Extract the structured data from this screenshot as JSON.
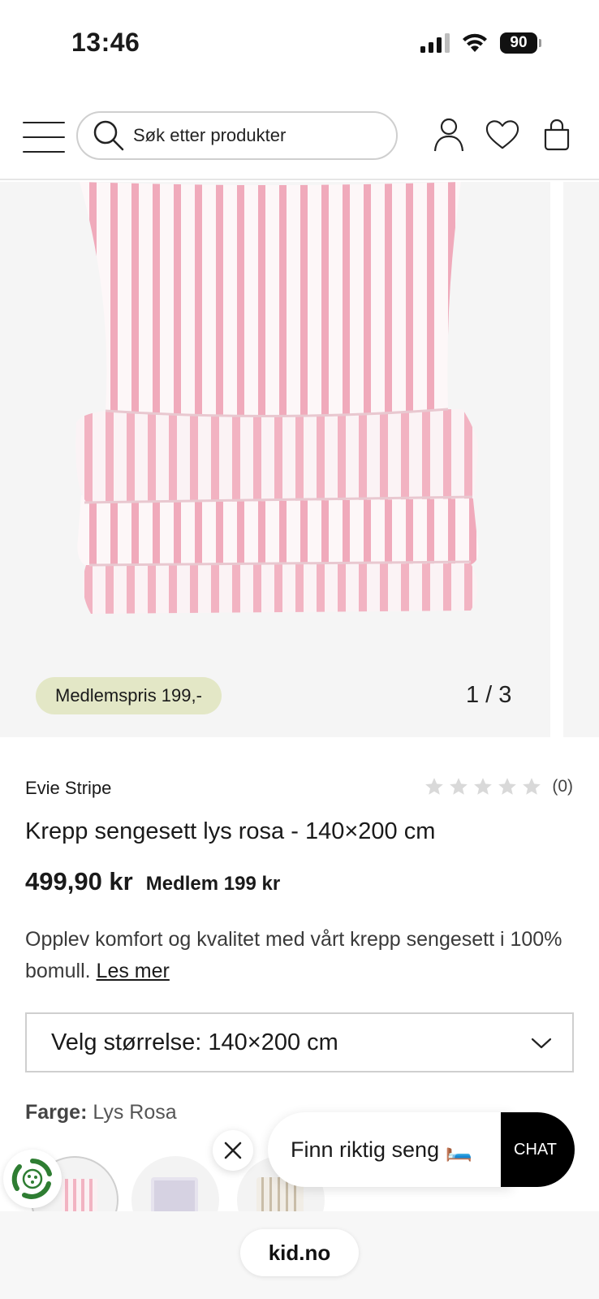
{
  "status_bar": {
    "time": "13:46",
    "battery": "90"
  },
  "header": {
    "search_placeholder": "Søk etter produkter"
  },
  "gallery": {
    "member_badge": "Medlemspris 199,-",
    "counter": "1 / 3"
  },
  "product": {
    "brand": "Evie Stripe",
    "rating_count": "(0)",
    "rating_value": 0,
    "title": "Krepp sengesett lys rosa - 140×200 cm",
    "price": "499,90 kr",
    "member_price": "Medlem 199 kr",
    "description": "Opplev komfort og kvalitet med vårt krepp sengesett i 100% bomull.",
    "read_more": "Les mer",
    "size_select": "Velg størrelse: 140×200 cm",
    "color_label": "Farge:",
    "color_value": "Lys Rosa"
  },
  "chat": {
    "prompt": "Finn riktig seng 🛏️",
    "button": "CHAT"
  },
  "browser": {
    "url": "kid.no"
  },
  "colors": {
    "pink_stripe": "#f3b6c4",
    "badge_bg": "#e3e7c6",
    "gallery_bg": "#f5f5f5"
  }
}
